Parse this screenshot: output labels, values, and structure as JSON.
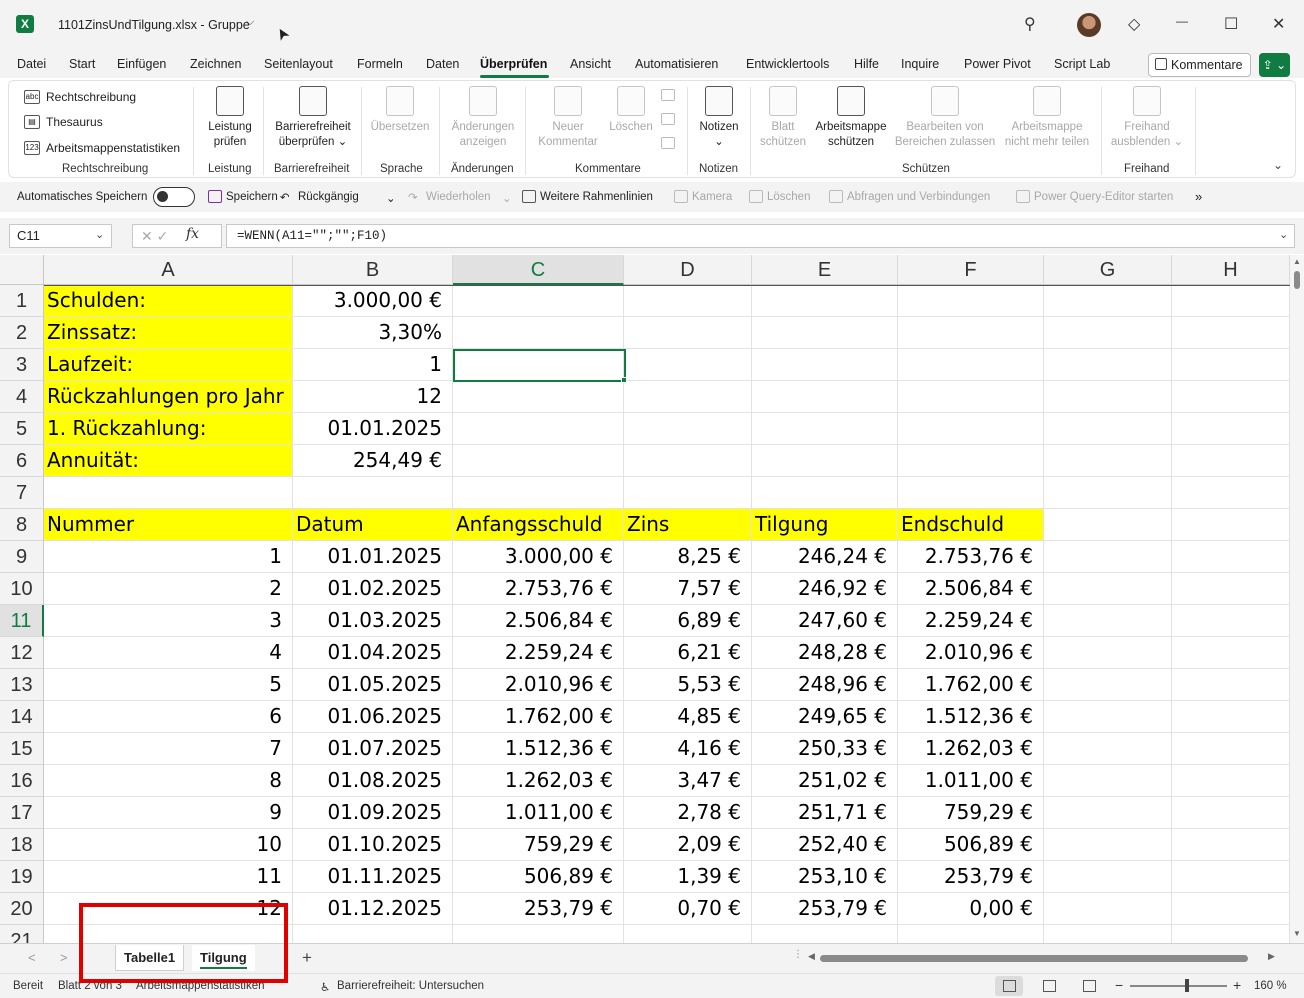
{
  "window": {
    "title": "1101ZinsUndTilgung.xlsx  -  Gruppe",
    "app_icon_glyph": "X",
    "chevron_glyph": "⌵",
    "cursor_glyph": "➤",
    "search_glyph": "⚲",
    "diamond_glyph": "◇",
    "minimize_glyph": "—",
    "maximize_glyph": "☐",
    "close_glyph": "✕"
  },
  "menu": {
    "tabs": [
      "Datei",
      "Start",
      "Einfügen",
      "Zeichnen",
      "Seitenlayout",
      "Formeln",
      "Daten",
      "Überprüfen",
      "Ansicht",
      "Automatisieren",
      "Entwicklertools",
      "Hilfe",
      "Inquire",
      "Power Pivot",
      "Script Lab"
    ],
    "active_tab": "Überprüfen",
    "comments_button": "Kommentare",
    "share_glyph": "⇪ ⌄"
  },
  "ribbon": {
    "rechtschreibung_items": [
      "Rechtschreibung",
      "Thesaurus",
      "Arbeitsmappenstatistiken"
    ],
    "rechtschreibung_icons": [
      "abc",
      "▤",
      "123"
    ],
    "groups": [
      "Rechtschreibung",
      "Leistung",
      "Barrierefreiheit",
      "Sprache",
      "Änderungen",
      "Kommentare",
      "Notizen",
      "Schützen",
      "Freihand"
    ],
    "leistung": [
      "Leistung",
      "prüfen"
    ],
    "barrierefreiheit": [
      "Barrierefreiheit",
      "überprüfen ⌄"
    ],
    "uebersetzen": "Übersetzen",
    "aenderungen": [
      "Änderungen",
      "anzeigen"
    ],
    "neuer_kommentar": [
      "Neuer",
      "Kommentar"
    ],
    "loeschen": "Löschen",
    "notizen": [
      "Notizen",
      "⌄"
    ],
    "blatt_schuetzen": [
      "Blatt",
      "schützen"
    ],
    "arbeitsmappe_schuetzen": [
      "Arbeitsmappe",
      "schützen"
    ],
    "bearbeiten_von": [
      "Bearbeiten von",
      "Bereichen zulassen"
    ],
    "arbeitsmappe_teilen": [
      "Arbeitsmappe",
      "nicht mehr teilen"
    ],
    "freihand": [
      "Freihand",
      "ausblenden ⌄"
    ],
    "collapse_glyph": "⌄"
  },
  "quick_access": {
    "autosave": "Automatisches Speichern",
    "speichern": "Speichern",
    "rueckgaengig": "Rückgängig",
    "undo_chevron": "⌄",
    "wiederholen": "Wiederholen",
    "redo_chevron": "⌄",
    "rahmenlinien": "Weitere Rahmenlinien",
    "kamera": "Kamera",
    "loeschen": "Löschen",
    "abfragen": "Abfragen und Verbindungen",
    "power_query": "Power Query-Editor starten",
    "more_glyph": "»"
  },
  "formula_bar": {
    "name_box": "C11",
    "name_box_chevron": "⌄",
    "cancel_confirm": "✕ ✓",
    "fx": "fx",
    "formula": "=WENN(A11=\"\";\"\";F10)",
    "expand_chevron": "⌄"
  },
  "grid": {
    "columns": [
      "A",
      "B",
      "C",
      "D",
      "E",
      "F",
      "G",
      "H"
    ],
    "selected_column": "C",
    "selected_row": 11,
    "rows": [
      {
        "n": 1,
        "cells": [
          "Schulden:",
          "3.000,00 €",
          "",
          "",
          "",
          ""
        ]
      },
      {
        "n": 2,
        "cells": [
          "Zinssatz:",
          "3,30%",
          "",
          "",
          "",
          ""
        ]
      },
      {
        "n": 3,
        "cells": [
          "Laufzeit:",
          "1",
          "",
          "",
          "",
          ""
        ]
      },
      {
        "n": 4,
        "cells": [
          "Rückzahlungen pro Jahr",
          "12",
          "",
          "",
          "",
          ""
        ]
      },
      {
        "n": 5,
        "cells": [
          "1. Rückzahlung:",
          "01.01.2025",
          "",
          "",
          "",
          ""
        ]
      },
      {
        "n": 6,
        "cells": [
          "Annuität:",
          "254,49 €",
          "",
          "",
          "",
          ""
        ]
      },
      {
        "n": 7,
        "cells": [
          "",
          "",
          "",
          "",
          "",
          ""
        ]
      },
      {
        "n": 8,
        "cells": [
          "Nummer",
          "Datum",
          "Anfangsschuld",
          "Zins",
          "Tilgung",
          "Endschuld"
        ]
      },
      {
        "n": 9,
        "cells": [
          "1",
          "01.01.2025",
          "3.000,00 €",
          "8,25 €",
          "246,24 €",
          "2.753,76 €"
        ]
      },
      {
        "n": 10,
        "cells": [
          "2",
          "01.02.2025",
          "2.753,76 €",
          "7,57 €",
          "246,92 €",
          "2.506,84 €"
        ]
      },
      {
        "n": 11,
        "cells": [
          "3",
          "01.03.2025",
          "2.506,84 €",
          "6,89 €",
          "247,60 €",
          "2.259,24 €"
        ]
      },
      {
        "n": 12,
        "cells": [
          "4",
          "01.04.2025",
          "2.259,24 €",
          "6,21 €",
          "248,28 €",
          "2.010,96 €"
        ]
      },
      {
        "n": 13,
        "cells": [
          "5",
          "01.05.2025",
          "2.010,96 €",
          "5,53 €",
          "248,96 €",
          "1.762,00 €"
        ]
      },
      {
        "n": 14,
        "cells": [
          "6",
          "01.06.2025",
          "1.762,00 €",
          "4,85 €",
          "249,65 €",
          "1.512,36 €"
        ]
      },
      {
        "n": 15,
        "cells": [
          "7",
          "01.07.2025",
          "1.512,36 €",
          "4,16 €",
          "250,33 €",
          "1.262,03 €"
        ]
      },
      {
        "n": 16,
        "cells": [
          "8",
          "01.08.2025",
          "1.262,03 €",
          "3,47 €",
          "251,02 €",
          "1.011,00 €"
        ]
      },
      {
        "n": 17,
        "cells": [
          "9",
          "01.09.2025",
          "1.011,00 €",
          "2,78 €",
          "251,71 €",
          "759,29 €"
        ]
      },
      {
        "n": 18,
        "cells": [
          "10",
          "01.10.2025",
          "759,29 €",
          "2,09 €",
          "252,40 €",
          "506,89 €"
        ]
      },
      {
        "n": 19,
        "cells": [
          "11",
          "01.11.2025",
          "506,89 €",
          "1,39 €",
          "253,10 €",
          "253,79 €"
        ]
      },
      {
        "n": 20,
        "cells": [
          "12",
          "01.12.2025",
          "253,79 €",
          "0,70 €",
          "253,79 €",
          "0,00 €"
        ]
      },
      {
        "n": 21,
        "cells": [
          "",
          "",
          "",
          "",
          "",
          ""
        ]
      }
    ],
    "highlight_color": "#ffff00"
  },
  "sheet_tabs": {
    "tabs": [
      "Tabelle1",
      "Tilgung"
    ],
    "active": "Tilgung",
    "add_glyph": "+",
    "prev_glyph": "<",
    "next_glyph": ">"
  },
  "status_bar": {
    "ready": "Bereit",
    "sheet_info": "Blatt 2 von 3",
    "stats": "Arbeitsmappenstatistiken",
    "accessibility": "Barrierefreiheit: Untersuchen",
    "zoom_minus": "−",
    "zoom_plus": "+",
    "zoom": "160 %",
    "zoom_level_percent": 160
  },
  "annotation_color": "#e00000",
  "accent_color": "#107c41"
}
